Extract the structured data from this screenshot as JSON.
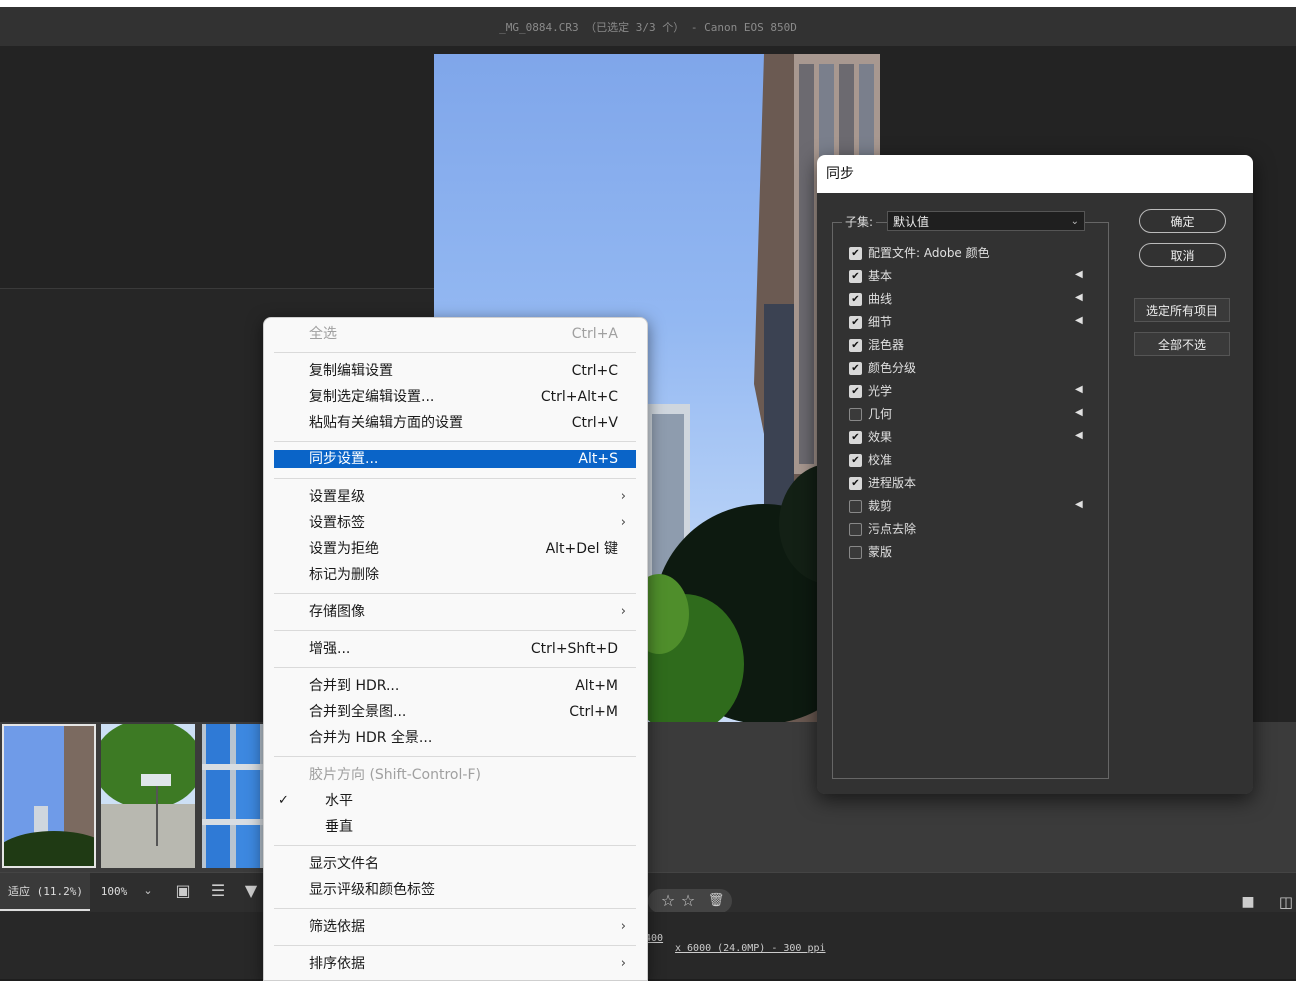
{
  "window": {
    "title": "_MG_0884.CR3 （已选定 3/3 个） - Canon EOS 850D"
  },
  "toolbar": {
    "zoom_fit": "适应 (11.2%)",
    "zoom_100": "100%"
  },
  "status": {
    "partial_left": "400",
    "partial_info": "x 6000 (24.0MP) - 300 ppi"
  },
  "context_menu": {
    "items": [
      {
        "label": "全选",
        "shortcut": "Ctrl+A",
        "disabled": true
      },
      {
        "label": "复制编辑设置",
        "shortcut": "Ctrl+C"
      },
      {
        "label": "复制选定编辑设置...",
        "shortcut": "Ctrl+Alt+C"
      },
      {
        "label": "粘贴有关编辑方面的设置",
        "shortcut": "Ctrl+V"
      },
      {
        "label": "同步设置...",
        "shortcut": "Alt+S",
        "selected": true
      },
      {
        "label": "设置星级"
      },
      {
        "label": "设置标签"
      },
      {
        "label": "设置为拒绝",
        "shortcut": "Alt+Del 键"
      },
      {
        "label": "标记为删除"
      },
      {
        "label": "存储图像"
      },
      {
        "label": "增强...",
        "shortcut": "Ctrl+Shft+D"
      },
      {
        "label": "合并到 HDR...",
        "shortcut": "Alt+M"
      },
      {
        "label": "合并到全景图...",
        "shortcut": "Ctrl+M"
      },
      {
        "label": "合并为 HDR 全景..."
      },
      {
        "label": "胶片方向 (Shift-Control-F)",
        "disabled": true
      },
      {
        "label": "水平",
        "checked": true
      },
      {
        "label": "垂直"
      },
      {
        "label": "显示文件名"
      },
      {
        "label": "显示评级和颜色标签"
      },
      {
        "label": "筛选依据"
      },
      {
        "label": "排序依据"
      }
    ]
  },
  "sync_dialog": {
    "title": "同步",
    "subset_label": "子集:",
    "subset_value": "默认值",
    "checkboxes": [
      {
        "label": "配置文件: Adobe 颜色",
        "checked": true
      },
      {
        "label": "基本",
        "checked": true
      },
      {
        "label": "曲线",
        "checked": true
      },
      {
        "label": "细节",
        "checked": true
      },
      {
        "label": "混色器",
        "checked": true
      },
      {
        "label": "颜色分级",
        "checked": true
      },
      {
        "label": "光学",
        "checked": true
      },
      {
        "label": "几何",
        "checked": false
      },
      {
        "label": "效果",
        "checked": true
      },
      {
        "label": "校准",
        "checked": true
      },
      {
        "label": "进程版本",
        "checked": true
      },
      {
        "label": "裁剪",
        "checked": false
      },
      {
        "label": "污点去除",
        "checked": false
      },
      {
        "label": "蒙版",
        "checked": false
      }
    ],
    "ok_label": "确定",
    "cancel_label": "取消",
    "select_all_label": "选定所有项目",
    "select_none_label": "全部不选"
  }
}
